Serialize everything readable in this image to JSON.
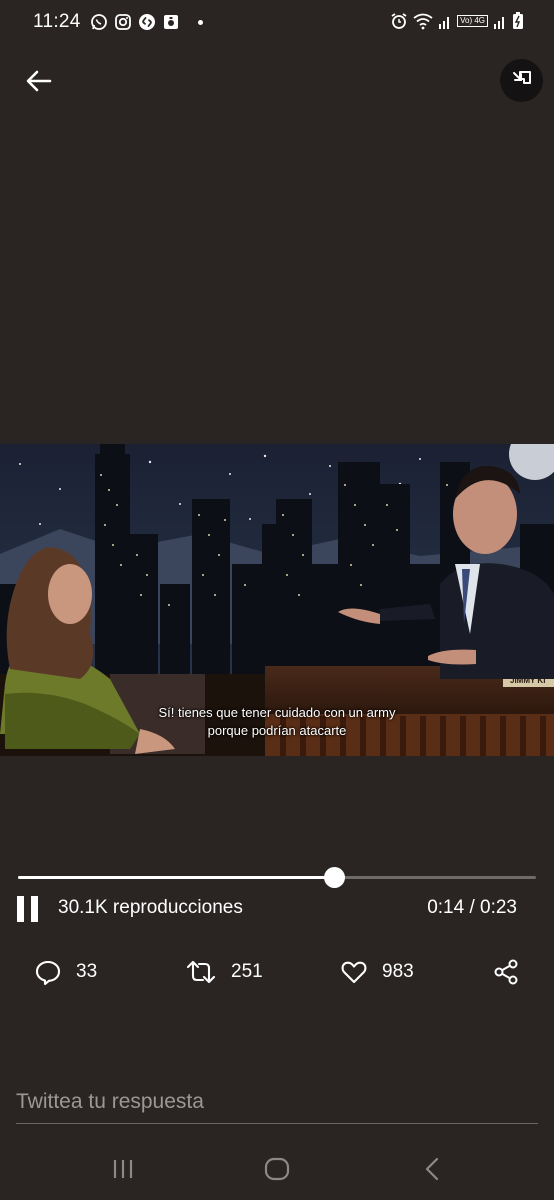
{
  "status_bar": {
    "time": "11:24",
    "left_icons": [
      "whatsapp-icon",
      "instagram-icon",
      "shazam-icon",
      "notification-app-icon",
      "dot"
    ],
    "right_icons": [
      "alarm-icon",
      "wifi-icon",
      "signal-icon",
      "volte-4g-icon",
      "signal-icon",
      "battery-charging-icon"
    ],
    "volte_label": "Vo) 4G"
  },
  "video": {
    "subtitle_line_1": "Sí! tienes que tener cuidado con un army",
    "subtitle_line_2": "porque podrían atacarte",
    "desk_sign": "JIMMY KI"
  },
  "player": {
    "progress": 0.61,
    "views": "30.1K reproducciones",
    "time": "0:14 / 0:23",
    "state": "playing"
  },
  "actions": {
    "replies": "33",
    "retweets": "251",
    "likes": "983"
  },
  "reply": {
    "placeholder": "Twittea tu respuesta"
  },
  "colors": {
    "background": "#2a2523",
    "text": "#ffffff",
    "muted": "#9c9795"
  }
}
